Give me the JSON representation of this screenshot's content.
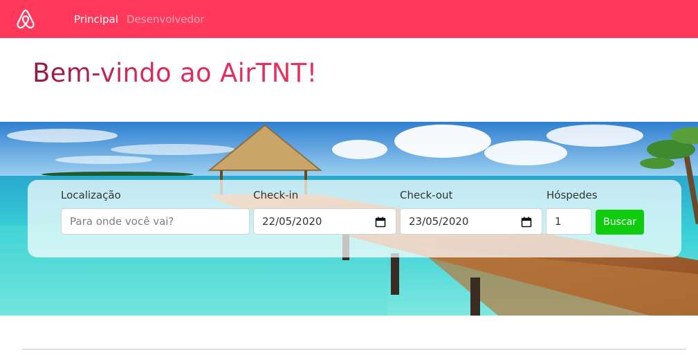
{
  "nav": {
    "logo_icon": "airbnb-logo-icon",
    "links": [
      {
        "label": "Principal",
        "active": true
      },
      {
        "label": "Desenvolvedor",
        "active": false
      }
    ],
    "bar_color": "#ff385c"
  },
  "main": {
    "welcome_title": "Bem-vindo ao AirTNT!"
  },
  "search": {
    "location": {
      "label": "Localização",
      "placeholder": "Para onde você vai?",
      "value": ""
    },
    "checkin": {
      "label": "Check-in",
      "value": "22/05/2020",
      "icon": "calendar-icon"
    },
    "checkout": {
      "label": "Check-out",
      "value": "23/05/2020",
      "icon": "calendar-icon"
    },
    "guests": {
      "label": "Hóspedes",
      "value": "1"
    },
    "button_label": "Buscar",
    "button_color": "#0fcc0f"
  }
}
